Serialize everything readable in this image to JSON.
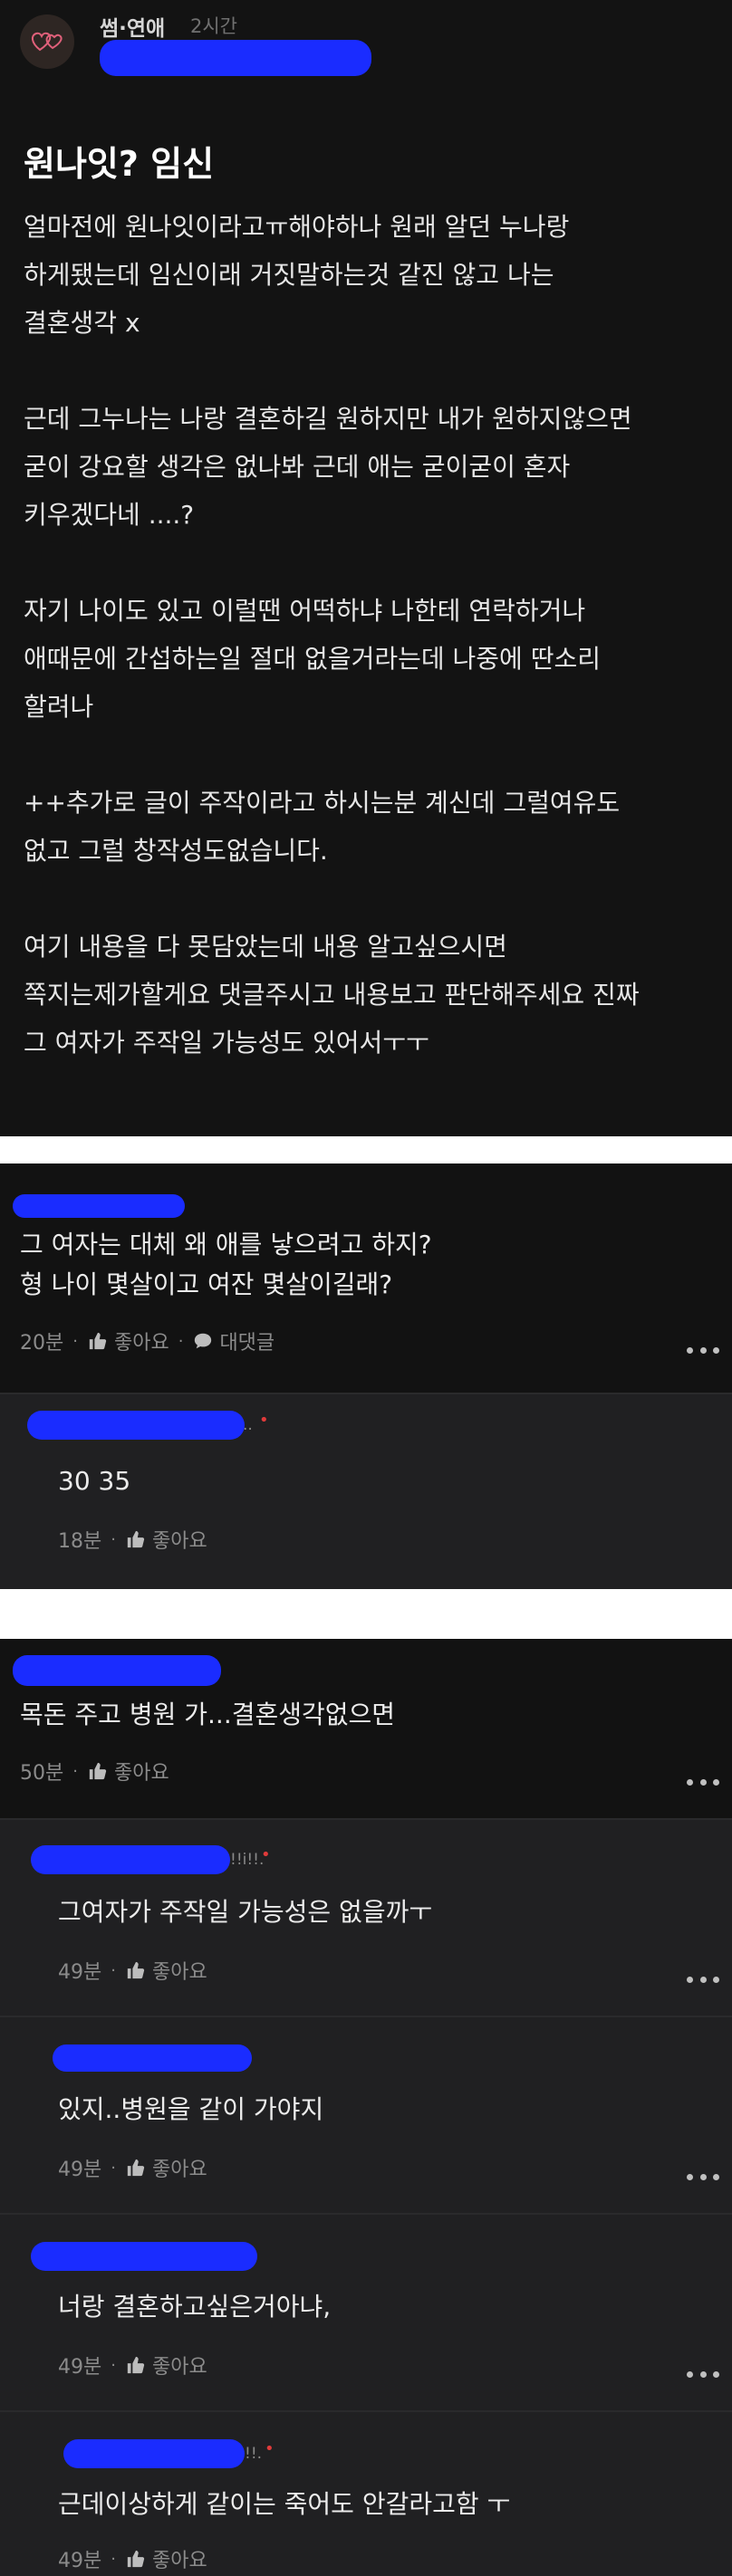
{
  "post": {
    "category": "썸·연애",
    "time": "2시간",
    "title": "원나잇? 임신",
    "body_lines": [
      "얼마전에 원나잇이라고ㅠ해야하나 원래 알던 누나랑",
      "하게됐는데 임신이래 거짓말하는것 같진 않고 나는",
      "결혼생각 x",
      "",
      "근데 그누나는 나랑 결혼하길 원하지만 내가 원하지않으면",
      "굳이 강요할 생각은 없나봐 근데 애는 굳이굳이 혼자",
      "키우겠다네 ....?",
      "",
      "자기 나이도 있고 이럴땐 어떡하냐 나한테 연락하거나",
      "애때문에 간섭하는일 절대 없을거라는데 나중에 딴소리",
      "할려나",
      "",
      "++추가로 글이 주작이라고 하시는분 계신데 그럴여유도",
      "없고 그럴 창작성도없습니다.",
      "",
      "여기 내용을 다 못담았는데 내용 알고싶으시면",
      "쪽지는제가할게요 댓글주시고 내용보고 판단해주세요 진짜",
      "그 여자가 주작일 가능성도 있어서ㅜㅜ"
    ]
  },
  "comments": [
    {
      "text_lines": [
        "그 여자는 대체 왜 애를 낳으려고 하지?",
        "형 나이 몇살이고 여잔 몇살이길래?"
      ],
      "time": "20분",
      "like_label": "좋아요",
      "reply_label": "대댓글"
    },
    {
      "name_tail": "..",
      "text": "30 35",
      "time": "18분",
      "like_label": "좋아요"
    },
    {
      "text": "목돈 주고 병원 가...결혼생각없으면",
      "time": "50분",
      "like_label": "좋아요"
    },
    {
      "name_tail": "!!i!!.",
      "text": "그여자가 주작일 가능성은 없을까ㅜ",
      "time": "49분",
      "like_label": "좋아요"
    },
    {
      "text": "있지..병원을 같이 가야지",
      "time": "49분",
      "like_label": "좋아요"
    },
    {
      "text": "너랑 결혼하고싶은거아냐,",
      "time": "49분",
      "like_label": "좋아요"
    },
    {
      "name_tail": "!!.",
      "text": "근데이상하게 같이는 죽어도 안갈라고함 ㅜ",
      "time": "49분",
      "like_label": "좋아요"
    }
  ],
  "colors": {
    "background": "#131313",
    "reply_background": "#202022",
    "redaction": "#1a2cff",
    "meta_text": "#8b8b8b"
  },
  "icons": [
    "heart-logo-icon",
    "thumbs-up-icon",
    "chat-bubble-icon",
    "more-dots-icon"
  ]
}
